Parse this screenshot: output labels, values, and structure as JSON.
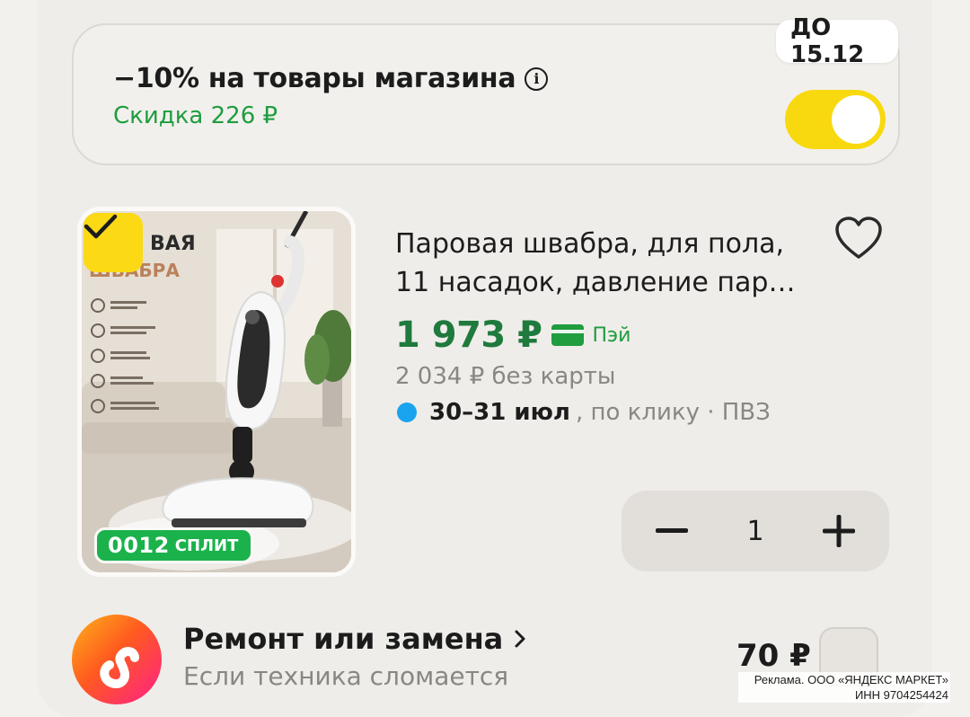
{
  "promo": {
    "title": "−10% на товары магазина",
    "discount": "Скидка 226 ₽",
    "deadline": "ДО 15.12",
    "toggle_on": true,
    "info_icon": "info-icon"
  },
  "product": {
    "title_line1": "Паровая швабра, для пола,",
    "title_line2": "11 насадок, давление пар…",
    "price": "1 973 ₽",
    "pay_label": "Пэй",
    "old_price": "2 034 ₽  без карты",
    "delivery_date": "30–31 июл",
    "delivery_rest": ", по клику · ПВЗ",
    "quantity": "1",
    "photo": {
      "brand_top": "ВАЯ",
      "brand_bottom": "ШВАБРА",
      "features": [
        "1300 Вт мощность",
        "Готова к работе за 25 секунд",
        "9 насадок в комплекте",
        "До 130 °С температура пара",
        "Уборка без химии чисто и безопасно"
      ]
    },
    "split_number": "0012",
    "split_label": "СПЛИТ",
    "selected": true
  },
  "service": {
    "title": "Ремонт или замена",
    "subtitle": "Если техника сломается",
    "price": "70 ₽",
    "checked": false
  },
  "ad_note": {
    "line1": "Реклама. ООО «ЯНДЕКС МАРКЕТ»",
    "line2": "ИНН 9704254424"
  },
  "colors": {
    "accent_yellow": "#f8d90f",
    "price_green": "#1f7a3d",
    "discount_green": "#1f9d3f",
    "delivery_dot": "#1aa4ef"
  }
}
